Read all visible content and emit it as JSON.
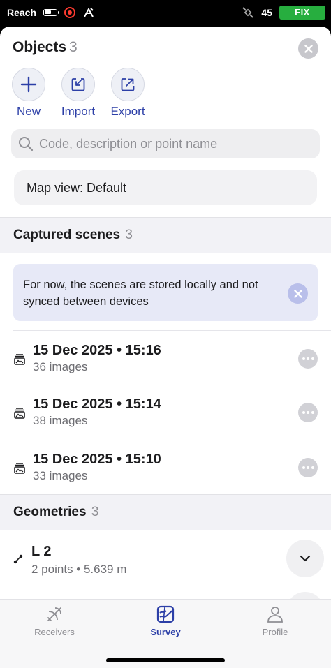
{
  "status_bar": {
    "carrier": "Reach",
    "satellites": "45",
    "fix": "FIX",
    "fix_color": "#27ae3f"
  },
  "header": {
    "title": "Objects",
    "count": "3"
  },
  "actions": [
    {
      "label": "New",
      "icon": "plus-icon"
    },
    {
      "label": "Import",
      "icon": "import-icon"
    },
    {
      "label": "Export",
      "icon": "export-icon"
    }
  ],
  "search": {
    "placeholder": "Code, description or point name",
    "value": ""
  },
  "map_view": {
    "label": "Map view: Default"
  },
  "scenes_section": {
    "title": "Captured scenes",
    "count": "3",
    "banner": "For now, the scenes are stored locally and not synced between devices",
    "items": [
      {
        "title": "15 Dec 2025 • 15:16",
        "subtitle": "36 images"
      },
      {
        "title": "15 Dec 2025 • 15:14",
        "subtitle": "38 images"
      },
      {
        "title": "15 Dec 2025 • 15:10",
        "subtitle": "33 images"
      }
    ]
  },
  "geometries_section": {
    "title": "Geometries",
    "count": "3",
    "items": [
      {
        "title": "L 2",
        "subtitle": "2 points • 5.639 m"
      }
    ]
  },
  "tabs": [
    {
      "label": "Receivers",
      "icon": "satellite-dish-icon",
      "active": false
    },
    {
      "label": "Survey",
      "icon": "survey-map-icon",
      "active": true
    },
    {
      "label": "Profile",
      "icon": "person-icon",
      "active": false
    }
  ],
  "colors": {
    "accent": "#2c3fa7",
    "banner_bg": "#e7e9f7"
  }
}
